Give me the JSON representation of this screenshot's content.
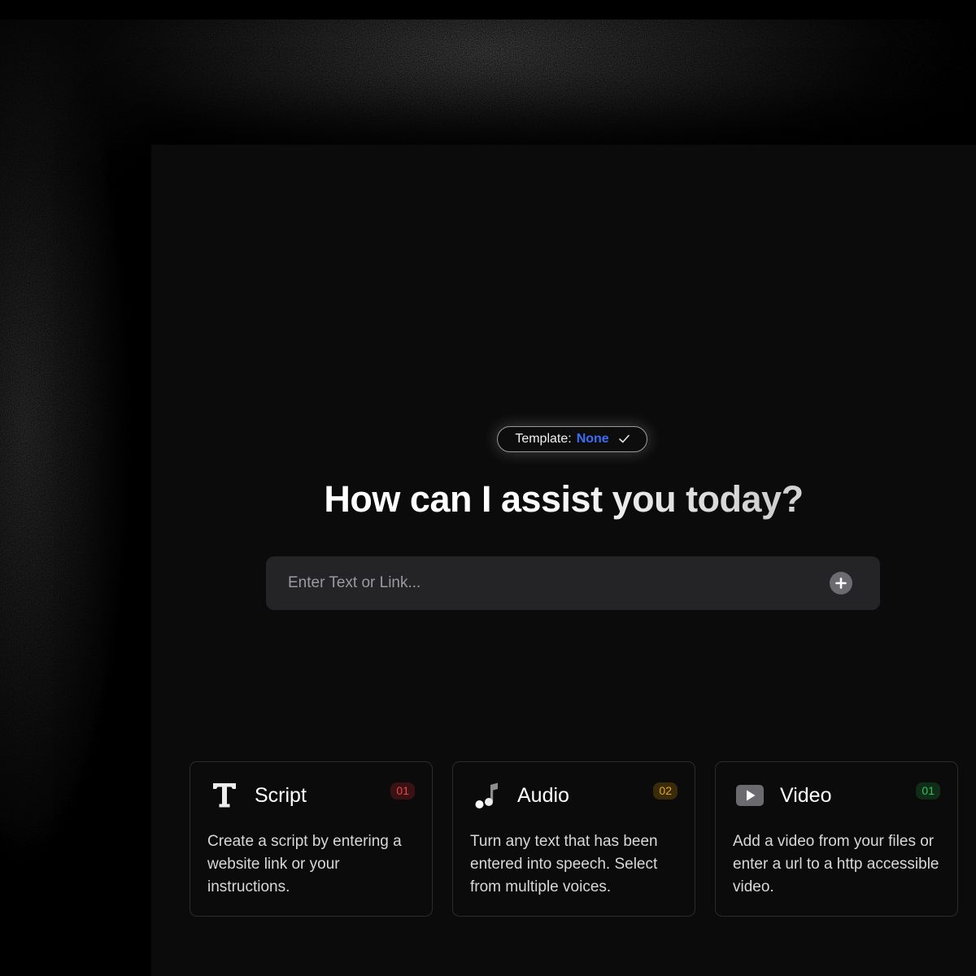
{
  "template": {
    "label": "Template:",
    "value": "None"
  },
  "headline": "How can I assist you today?",
  "input": {
    "placeholder": "Enter Text or Link..."
  },
  "cards": [
    {
      "title": "Script",
      "badge": "01",
      "icon": "text-icon",
      "badge_color": "#e5484d",
      "badge_bg": "#3a1214",
      "description": "Create a script by entering a website link or your instructions."
    },
    {
      "title": "Audio",
      "badge": "02",
      "icon": "music-note-icon",
      "badge_color": "#e3a512",
      "badge_bg": "#3a2c08",
      "description": "Turn any text that has been entered into speech. Select from multiple voices."
    },
    {
      "title": "Video",
      "badge": "01",
      "icon": "play-icon",
      "badge_color": "#3dbd5c",
      "badge_bg": "#0f2d17",
      "description": "Add a video from your files or enter a url to a http accessible video."
    }
  ],
  "colors": {
    "accent": "#3b6cf6",
    "input_bg": "#242427",
    "panel_bg": "#0b0b0b"
  }
}
